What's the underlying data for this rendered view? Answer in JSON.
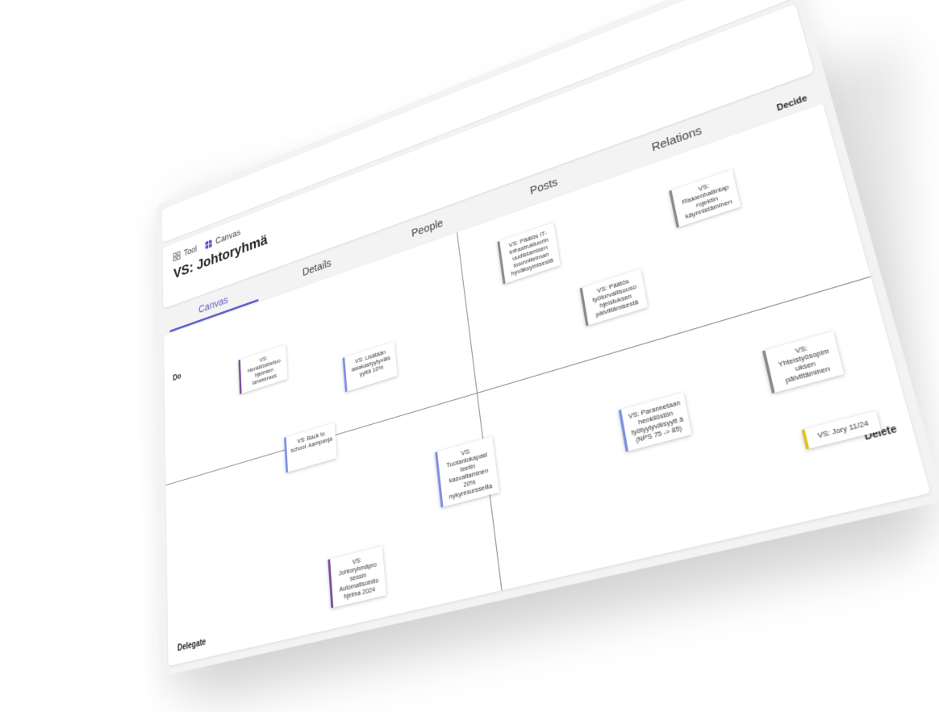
{
  "breadcrumbs": {
    "tool": "Tool",
    "canvas": "Canvas"
  },
  "page_title": "VS: Johtoryhmä",
  "tabs": [
    "Canvas",
    "Details",
    "People",
    "Posts",
    "Relations"
  ],
  "active_tab": "Canvas",
  "quadrants": {
    "do": "Do",
    "decide": "Decide",
    "delegate": "Delegate",
    "delete": "Delete"
  },
  "notes": {
    "do_1": "VS: Henkilöstöetuo hjelmien lanseeraus",
    "do_2": "VS: Lisätään asiakastyytyväis yyttä 10%",
    "do_3": "VS: Back to school -kampanja",
    "decide_1": "VS: Päätös IT-infrastruktuurin uudistamisen suunnitelman hyväksymisestä",
    "decide_2": "VS: Riskienhallintap rojektin käynnistäminen",
    "decide_3": "VS: Päätös työturvallisuuso hjeistuksen päivittämisestä",
    "delegate_1": "VS: Tuotantokapasi teetin kasvattaminen 20% nykyresursseilla",
    "delegate_2": "VS: Johtoryhmäpro sessin Automatisointio hjelma 2024",
    "delete_1": "VS: Parannetaan henkilöstön työtyytyväisyytt ä (NPS 75 -> 85)",
    "delete_2": "VS: Yhteistyösopim uksen päivittäminen",
    "delete_3": "VS: Jory 11/24"
  },
  "colors": {
    "accent": "#5b5fc7",
    "purple": "#7a4f9a",
    "blue": "#7b8fe6",
    "gray": "#8a8a8a",
    "yellow": "#e0c020"
  }
}
